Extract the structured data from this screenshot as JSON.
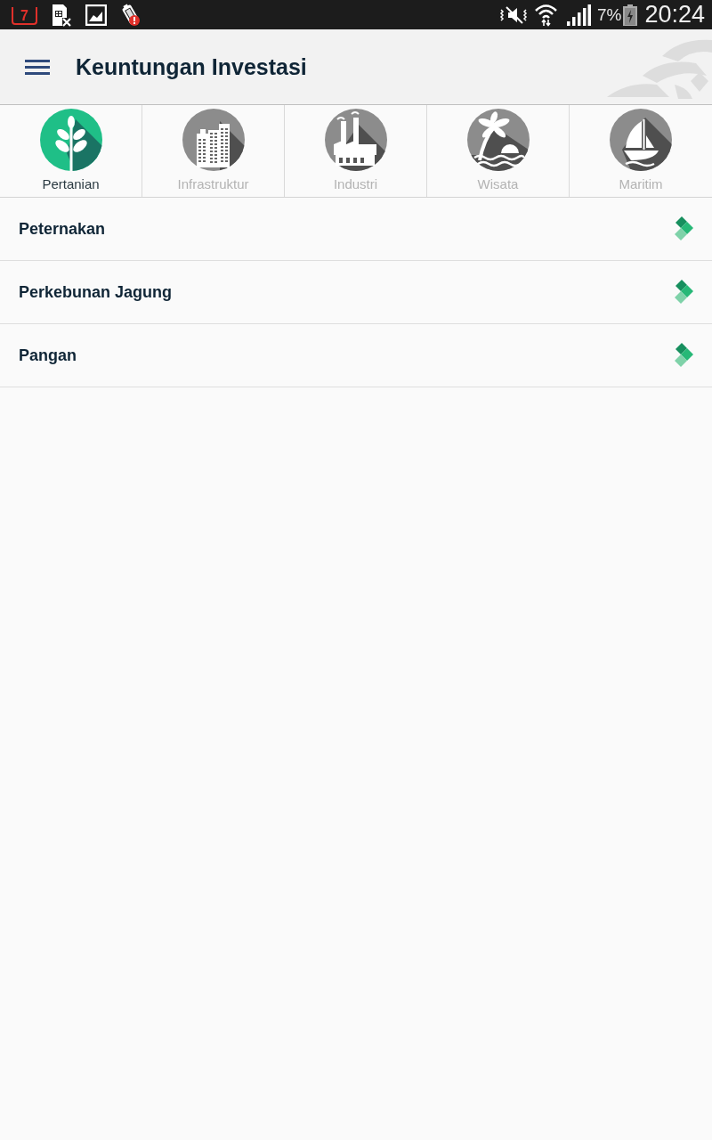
{
  "status_bar": {
    "calendar_day": "7",
    "battery": "7%",
    "time": "20:24"
  },
  "header": {
    "title": "Keuntungan Investasi"
  },
  "categories": [
    {
      "label": "Pertanian",
      "kind": "plant",
      "selected": true
    },
    {
      "label": "Infrastruktur",
      "kind": "buildings",
      "selected": false
    },
    {
      "label": "Industri",
      "kind": "factory",
      "selected": false
    },
    {
      "label": "Wisata",
      "kind": "beach",
      "selected": false
    },
    {
      "label": "Maritim",
      "kind": "boat",
      "selected": false
    }
  ],
  "items": [
    {
      "label": "Peternakan"
    },
    {
      "label": "Perkebunan Jagung"
    },
    {
      "label": "Pangan"
    }
  ]
}
